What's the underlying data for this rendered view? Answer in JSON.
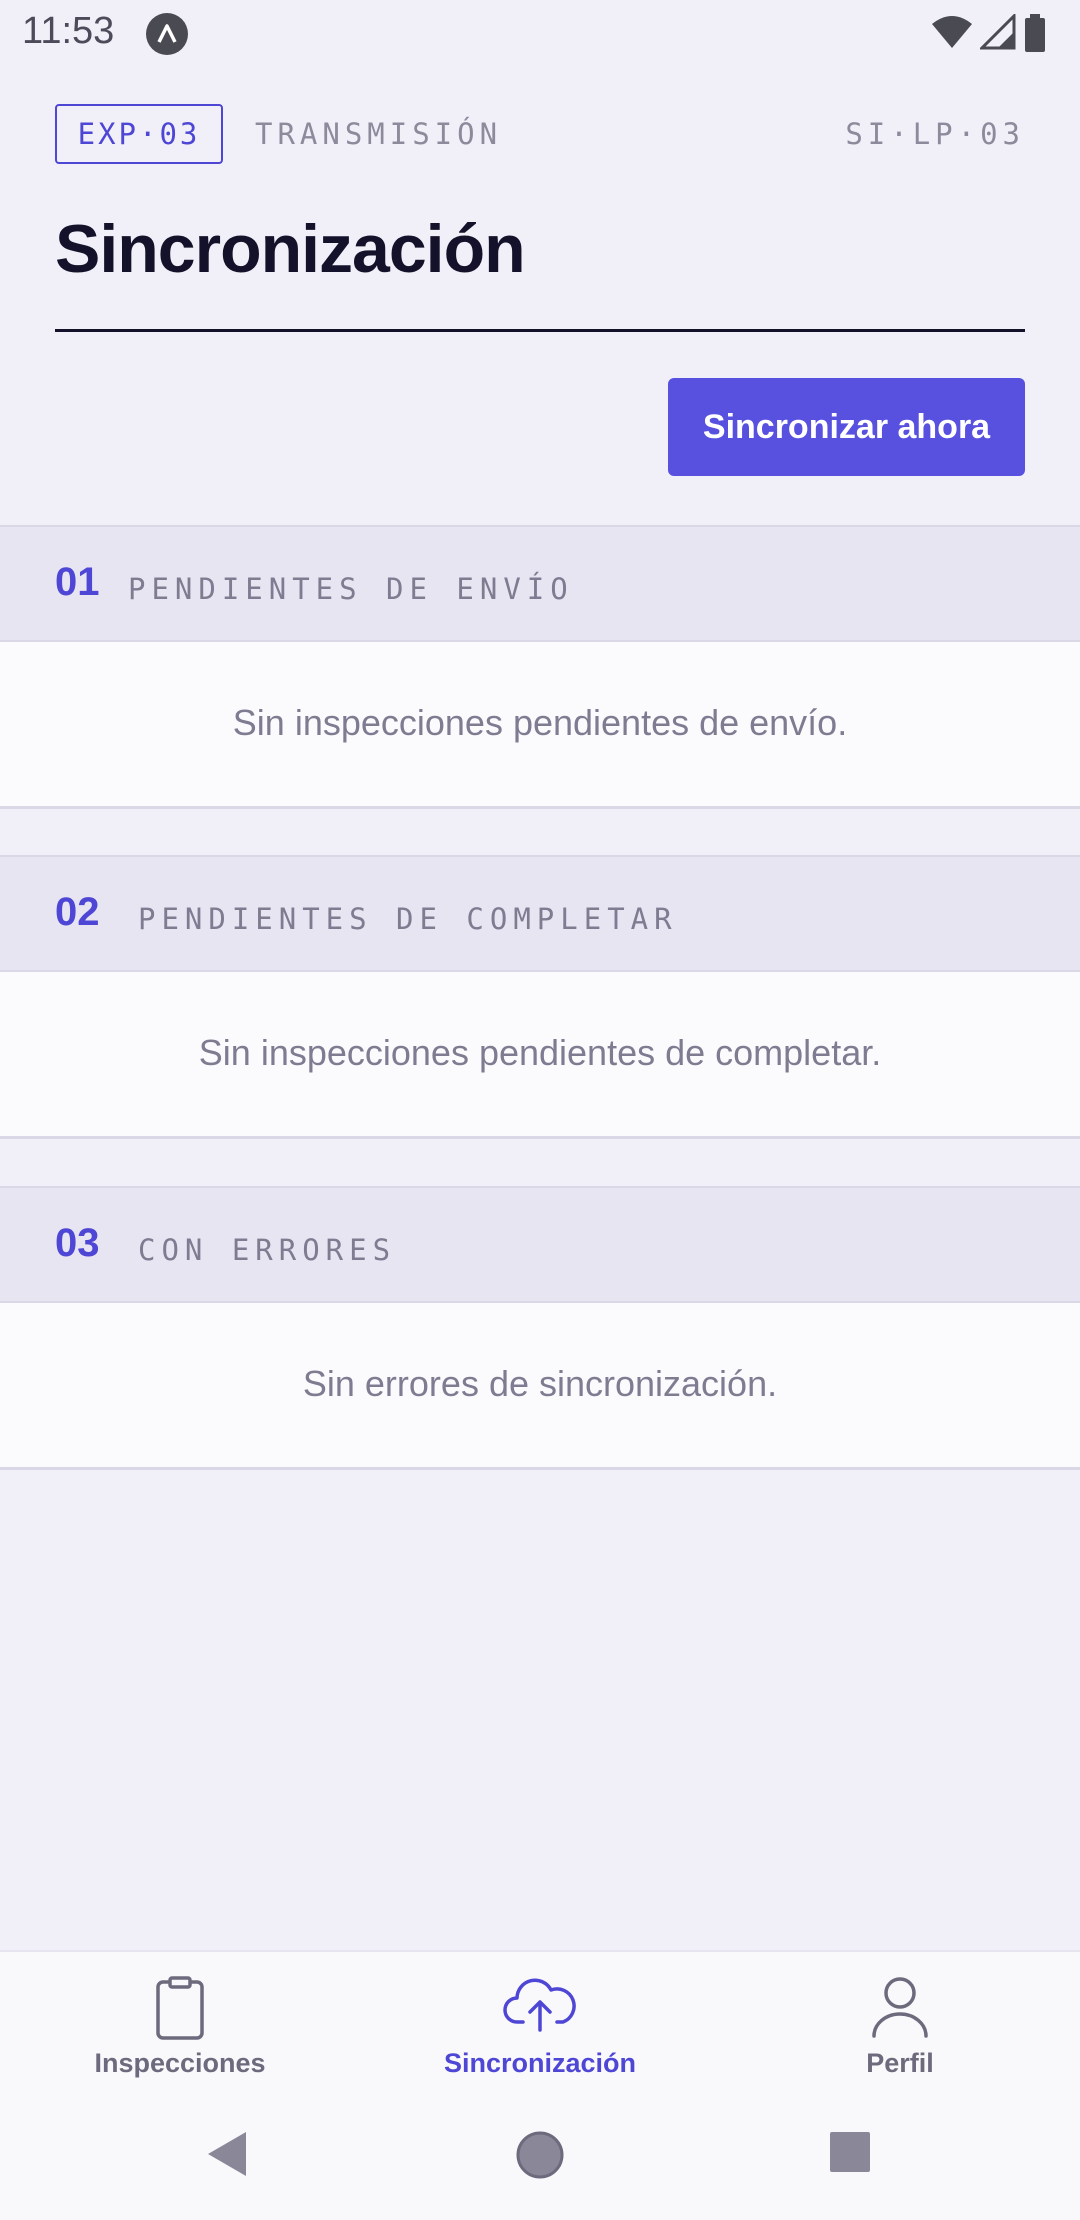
{
  "status_bar": {
    "time": "11:53",
    "app_icon": "a-logo-icon",
    "indicators": [
      "wifi-icon",
      "cell-signal-icon",
      "battery-icon"
    ]
  },
  "header": {
    "tag": "EXP·03",
    "kicker": "TRANSMISIÓN",
    "code": "SI·LP·03",
    "title": "Sincronización"
  },
  "actions": {
    "sync_now_label": "Sincronizar ahora"
  },
  "sections": [
    {
      "number": "01",
      "label": "PENDIENTES DE ENVÍO",
      "empty_message": "Sin inspecciones pendientes de envío."
    },
    {
      "number": "02",
      "label": "PENDIENTES DE COMPLETAR",
      "empty_message": "Sin inspecciones pendientes de completar."
    },
    {
      "number": "03",
      "label": "CON ERRORES",
      "empty_message": "Sin errores de sincronización."
    }
  ],
  "bottom_nav": {
    "items": [
      {
        "label": "Inspecciones",
        "icon": "clipboard-icon",
        "active": false
      },
      {
        "label": "Sincronización",
        "icon": "cloud-upload-icon",
        "active": true
      },
      {
        "label": "Perfil",
        "icon": "person-icon",
        "active": false
      }
    ]
  },
  "system_nav": [
    "back-icon",
    "home-icon",
    "recents-icon"
  ],
  "colors": {
    "accent": "#5851e0",
    "background": "#f1f0f8",
    "section_header": "#e7e5f2",
    "muted_text": "#7f7c92"
  }
}
